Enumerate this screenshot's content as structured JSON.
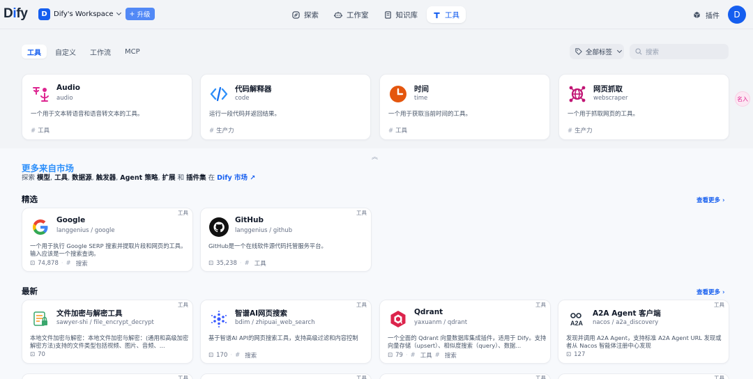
{
  "header": {
    "logo": "Dify",
    "workspace_initial": "D",
    "workspace_name": "Dify's Workspace",
    "upgrade_label": "升级",
    "nav": [
      {
        "label": "探索",
        "icon": "compass-icon"
      },
      {
        "label": "工作室",
        "icon": "robot-icon"
      },
      {
        "label": "知识库",
        "icon": "book-icon"
      },
      {
        "label": "工具",
        "icon": "tool-icon",
        "active": true
      }
    ],
    "plugin_label": "插件",
    "user_initial": "D"
  },
  "tabs": [
    "工具",
    "自定义",
    "工作流",
    "MCP"
  ],
  "filters": {
    "tags_label": "全部标签",
    "search_placeholder": "搜索"
  },
  "tool_cards": [
    {
      "name": "Audio",
      "sub": "audio",
      "desc": "一个用于文本转语音和语音转文本的工具。",
      "tag": "工具",
      "icon": "audio-icon"
    },
    {
      "name": "代码解释器",
      "sub": "code",
      "desc": "运行一段代码并返回结果。",
      "tag": "生产力",
      "icon": "code-icon"
    },
    {
      "name": "时间",
      "sub": "time",
      "desc": "一个用于获取当前时间的工具。",
      "tag": "工具",
      "icon": "clock-icon"
    },
    {
      "name": "网页抓取",
      "sub": "webscraper",
      "desc": "一个用于抓取网页的工具。",
      "tag": "生产力",
      "icon": "webscraper-icon"
    }
  ],
  "float_badge": "名入",
  "marketplace": {
    "title": "更多来自市场",
    "subtitle": {
      "prefix": "探索 ",
      "parts": [
        "模型",
        "工具",
        "数据源",
        "触发器",
        "Agent 策略",
        "扩展"
      ],
      "sep": ", ",
      "and": " 和 ",
      "last": "插件集",
      "in": " 在 ",
      "link": "Dify 市场 ↗"
    },
    "featured_title": "精选",
    "latest_title": "最新",
    "see_more": "查看更多",
    "featured": [
      {
        "name": "Google",
        "org": "langgenius",
        "repo": "google",
        "desc": "一个用于执行 Google SERP 搜索并提取片段和网页的工具。输入应该是一个搜索查询。",
        "installs": "74,878",
        "tags": [
          "搜索"
        ],
        "kind": "工具",
        "icon": "google-icon"
      },
      {
        "name": "GitHub",
        "org": "langgenius",
        "repo": "github",
        "desc": "GitHub是一个在线软件源代码托管服务平台。",
        "installs": "35,238",
        "tags": [
          "工具"
        ],
        "kind": "工具",
        "icon": "github-icon"
      }
    ],
    "latest": [
      {
        "name": "文件加密与解密工具",
        "org": "sawyer-shi",
        "repo": "file_encrypt_decrypt",
        "desc": "本地文件加密与解密：本地文件加密与解密：(通用和高级加密解密方法)支持的文件类型包括视频、图片、音频、...",
        "installs": "70",
        "tags": [],
        "kind": "工具",
        "icon": "file-lock-icon"
      },
      {
        "name": "智谱AI网页搜索",
        "org": "bdim",
        "repo": "zhipuai_web_search",
        "desc": "基于智谱AI API的网页搜索工具，支持高级过滤和内容控制",
        "installs": "170",
        "tags": [
          "搜索"
        ],
        "kind": "工具",
        "icon": "zhipu-icon"
      },
      {
        "name": "Qdrant",
        "org": "yaxuanm",
        "repo": "qdrant",
        "desc": "一个全面的 Qdrant 向量数据库集成插件，适用于 Dify。支持向量存储（upsert）、相似度搜索（query）、数据...",
        "installs": "79",
        "tags": [
          "工具",
          "搜索"
        ],
        "kind": "工具",
        "icon": "qdrant-icon"
      },
      {
        "name": "A2A Agent 客户端",
        "org": "nacos",
        "repo": "a2a_discovery",
        "desc": "发现并调用 A2A Agent，支持标准 A2A Agent URL 发现或者从 Nacos 智能体注册中心发现",
        "installs": "127",
        "tags": [],
        "kind": "工具",
        "icon": "a2a-icon"
      }
    ],
    "stub_kind": "工具"
  },
  "colors": {
    "accent": "#155eef",
    "market_title": "#2e90fa",
    "bg": "#f2f4f7"
  }
}
